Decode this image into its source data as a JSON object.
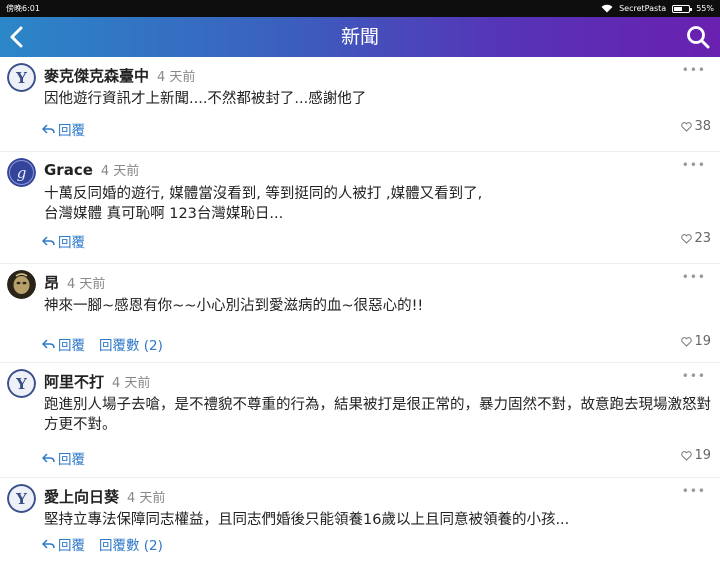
{
  "status": {
    "time": "傍晚6:01",
    "carrier": "SecretPasta",
    "battery": "55%",
    "battery_level": 0.55
  },
  "header": {
    "title": "新聞",
    "back_icon": "chevron-left-icon",
    "search_icon": "search-icon"
  },
  "comments": [
    {
      "author": "麥克傑克森臺中",
      "time": "4 天前",
      "text": "因他遊行資訊才上新聞....不然都被封了...感謝他了",
      "reply": "回覆",
      "replies": "",
      "likes": "38"
    },
    {
      "author": "Grace",
      "time": "4 天前",
      "text": "十萬反同婚的遊行, 媒體當沒看到, 等到挺同的人被打 ,媒體又看到了,\n台灣媒體 真可恥啊 123台灣媒恥日...",
      "reply": "回覆",
      "replies": "",
      "likes": "23"
    },
    {
      "author": "昂",
      "time": "4 天前",
      "text": "神來一腳~感恩有你~~小心別沾到愛滋病的血~很惡心的!!",
      "reply": "回覆",
      "replies": "回覆數 (2)",
      "likes": "19"
    },
    {
      "author": "阿里不打",
      "time": "4 天前",
      "text": "跑進別人場子去嗆，是不禮貌不尊重的行為，結果被打是很正常的，暴力固然不對，故意跑去現場激怒對方更不對。",
      "reply": "回覆",
      "replies": "",
      "likes": "19"
    },
    {
      "author": "愛上向日葵",
      "time": "4 天前",
      "text": "堅持立專法保障同志權益，且同志們婚後只能領養16歲以上且同意被領養的小孩...",
      "reply": "回覆",
      "replies": "回覆數 (2)",
      "likes": ""
    }
  ]
}
